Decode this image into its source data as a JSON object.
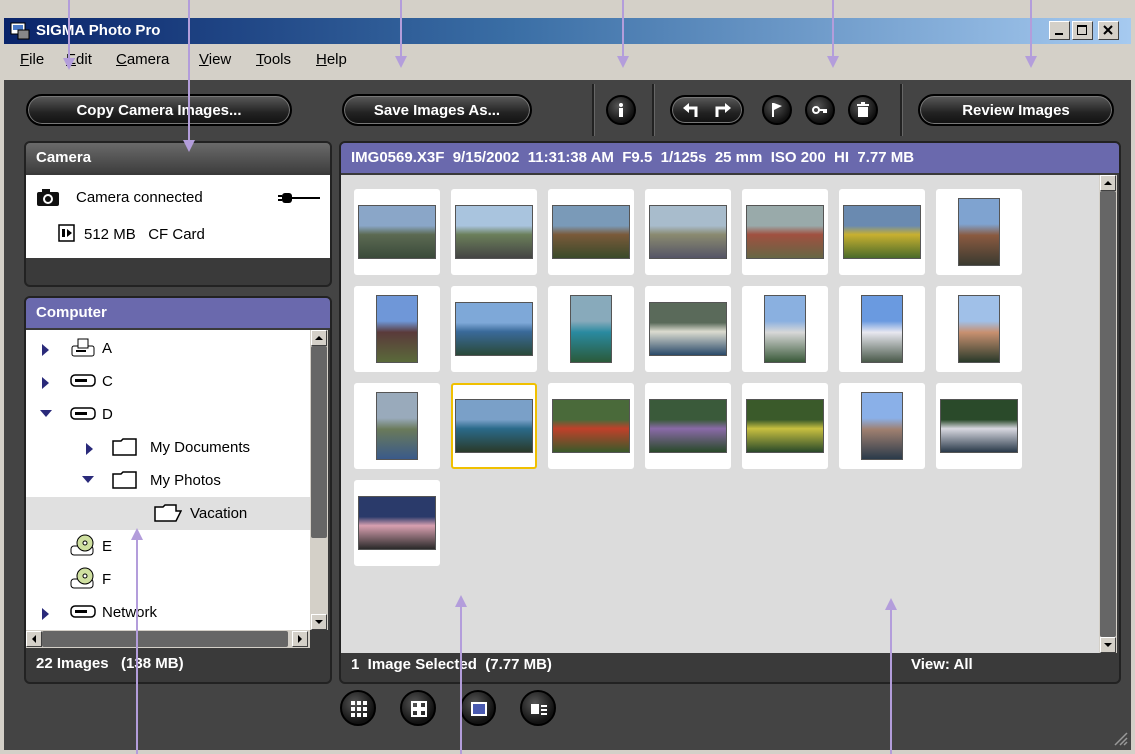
{
  "window": {
    "title": "SIGMA Photo Pro"
  },
  "menu": [
    {
      "label": "File",
      "key": "F",
      "rest": "ile"
    },
    {
      "label": "Edit",
      "key": "E",
      "rest": "dit"
    },
    {
      "label": "Camera",
      "key": "C",
      "rest": "amera"
    },
    {
      "label": "View",
      "key": "V",
      "rest": "iew"
    },
    {
      "label": "Tools",
      "key": "T",
      "rest": "ools"
    },
    {
      "label": "Help",
      "key": "H",
      "rest": "elp"
    }
  ],
  "toolbar": {
    "copy_label": "Copy Camera Images...",
    "save_label": "Save Images As...",
    "review_label": "Review Images"
  },
  "camera_panel": {
    "title": "Camera",
    "status": "Camera connected",
    "card": "512 MB   CF Card"
  },
  "computer_panel": {
    "title": "Computer",
    "tree": [
      {
        "label": "A",
        "icon": "floppy-drive-icon"
      },
      {
        "label": "C",
        "icon": "hard-drive-icon"
      },
      {
        "label": "D",
        "icon": "hard-drive-icon"
      },
      {
        "label": "My Documents",
        "icon": "folder-icon"
      },
      {
        "label": "My Photos",
        "icon": "folder-icon"
      },
      {
        "label": "Vacation",
        "icon": "open-folder-icon"
      },
      {
        "label": "E",
        "icon": "cd-drive-icon"
      },
      {
        "label": "F",
        "icon": "cd-drive-icon"
      },
      {
        "label": "Network",
        "icon": "network-drive-icon"
      }
    ]
  },
  "image_info": "IMG0569.X3F  9/15/2002  11:31:38 AM  F9.5  1/125s  25 mm  ISO 200  HI  7.77 MB",
  "status": {
    "left": "22 Images   (138 MB)",
    "selected": "1  Image Selected  (7.77 MB)",
    "view": "View: All"
  },
  "thumbnails": [
    {
      "name": "bridge",
      "colors": [
        "#8aa6c8",
        "#5c6a52",
        "#3a4a3a"
      ]
    },
    {
      "name": "arch-bridge",
      "colors": [
        "#a9c4de",
        "#6b7f5a",
        "#444"
      ]
    },
    {
      "name": "ruin",
      "colors": [
        "#7a9ab8",
        "#7a5a3a",
        "#3a4a2a"
      ]
    },
    {
      "name": "stone-house",
      "colors": [
        "#a8bccc",
        "#8a8a70",
        "#556"
      ]
    },
    {
      "name": "brick-wall",
      "colors": [
        "#9aa",
        "#a05040",
        "#664"
      ]
    },
    {
      "name": "field",
      "colors": [
        "#6a8ab0",
        "#c8b030",
        "#4a6a2a"
      ]
    },
    {
      "name": "chimney",
      "colors": [
        "#7fa3d0",
        "#8a5a40",
        "#3a3a30"
      ]
    },
    {
      "name": "moose",
      "colors": [
        "#6f97d8",
        "#5a3a3a",
        "#5a6a3a"
      ]
    },
    {
      "name": "lake",
      "colors": [
        "#7ea8d8",
        "#3a6a9a",
        "#2a4a3a"
      ]
    },
    {
      "name": "waterfall",
      "colors": [
        "#8ab",
        "#2a8aa0",
        "#2a5a3a"
      ]
    },
    {
      "name": "canoes",
      "colors": [
        "#5a6a5a",
        "#dcdcd0",
        "#2a4a6a"
      ]
    },
    {
      "name": "river",
      "colors": [
        "#8ab0e0",
        "#d8d8d8",
        "#3a5a3a"
      ]
    },
    {
      "name": "mountains",
      "colors": [
        "#6a9ae0",
        "#e8e8f0",
        "#4a5a4a"
      ]
    },
    {
      "name": "peak",
      "colors": [
        "#a0c0e8",
        "#c89070",
        "#2a3a2a"
      ]
    },
    {
      "name": "hiker",
      "colors": [
        "#9ab",
        "#6a7a5a",
        "#3a5a8a"
      ]
    },
    {
      "name": "sitting",
      "colors": [
        "#7aa0c8",
        "#2a6a8a",
        "#2a3a2a"
      ]
    },
    {
      "name": "flowers-red",
      "colors": [
        "#4a6a3a",
        "#c0402a",
        "#3a5a2a"
      ]
    },
    {
      "name": "flowers-purple",
      "colors": [
        "#3a5a3a",
        "#8a6aa8",
        "#2a4a2a"
      ]
    },
    {
      "name": "flowers-yellow",
      "colors": [
        "#3a5a2a",
        "#c8c040",
        "#2a4a2a"
      ]
    },
    {
      "name": "canyon",
      "colors": [
        "#8ab0e8",
        "#a08070",
        "#2a3a4a"
      ]
    },
    {
      "name": "boat",
      "colors": [
        "#2a4a2a",
        "#d8d8e0",
        "#2a3a4a"
      ]
    },
    {
      "name": "sunset",
      "colors": [
        "#2a3a6a",
        "#d8a0b0",
        "#2a2a2a"
      ]
    }
  ]
}
